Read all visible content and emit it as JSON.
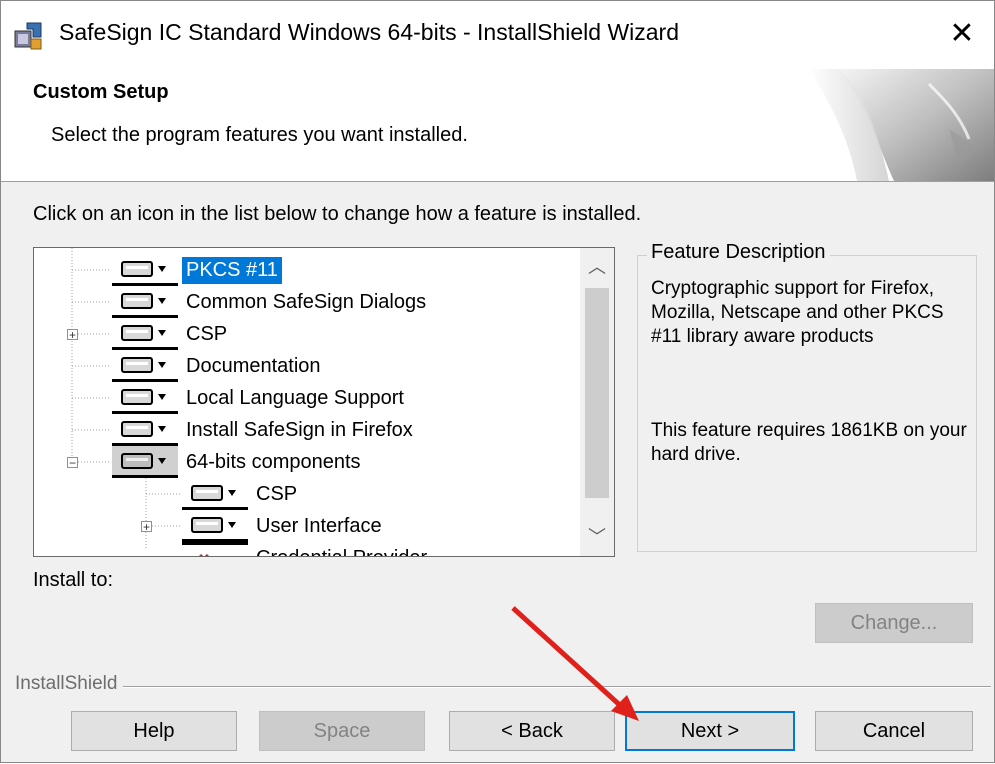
{
  "window": {
    "title": "SafeSign IC Standard Windows 64-bits - InstallShield Wizard",
    "close_glyph": "✕"
  },
  "header": {
    "heading": "Custom Setup",
    "subheading": "Select the program features you want installed."
  },
  "instruction": "Click on an icon in the list below to change how a feature is installed.",
  "features": [
    {
      "label": "PKCS #11",
      "state": "installed",
      "selected": true
    },
    {
      "label": "Common SafeSign Dialogs",
      "state": "installed",
      "selected": false
    },
    {
      "label": "CSP",
      "state": "installed",
      "selected": false
    },
    {
      "label": "Documentation",
      "state": "installed",
      "selected": false
    },
    {
      "label": "Local Language Support",
      "state": "installed",
      "selected": false
    },
    {
      "label": "Install SafeSign in Firefox",
      "state": "installed",
      "selected": false
    },
    {
      "label": "64-bits components",
      "state": "installed",
      "selected": false
    },
    {
      "label": "CSP",
      "state": "installed",
      "selected": false
    },
    {
      "label": "User Interface",
      "state": "installed",
      "selected": false
    },
    {
      "label": "Credential Provider",
      "state": "not-installed",
      "selected": false
    }
  ],
  "description": {
    "title": "Feature Description",
    "text": "Cryptographic support for Firefox, Mozilla, Netscape and other PKCS #11 library aware products",
    "size_text": "This feature requires 1861KB on your hard drive."
  },
  "install_to": {
    "label": "Install to:",
    "change_label": "Change..."
  },
  "footer": {
    "brand": "InstallShield",
    "help_label": "Help",
    "space_label": "Space",
    "back_label": "< Back",
    "next_label": "Next >",
    "cancel_label": "Cancel"
  },
  "colors": {
    "selection": "#0078d7",
    "annotation_arrow": "#e0201b",
    "not_installed": "#c0282b"
  }
}
